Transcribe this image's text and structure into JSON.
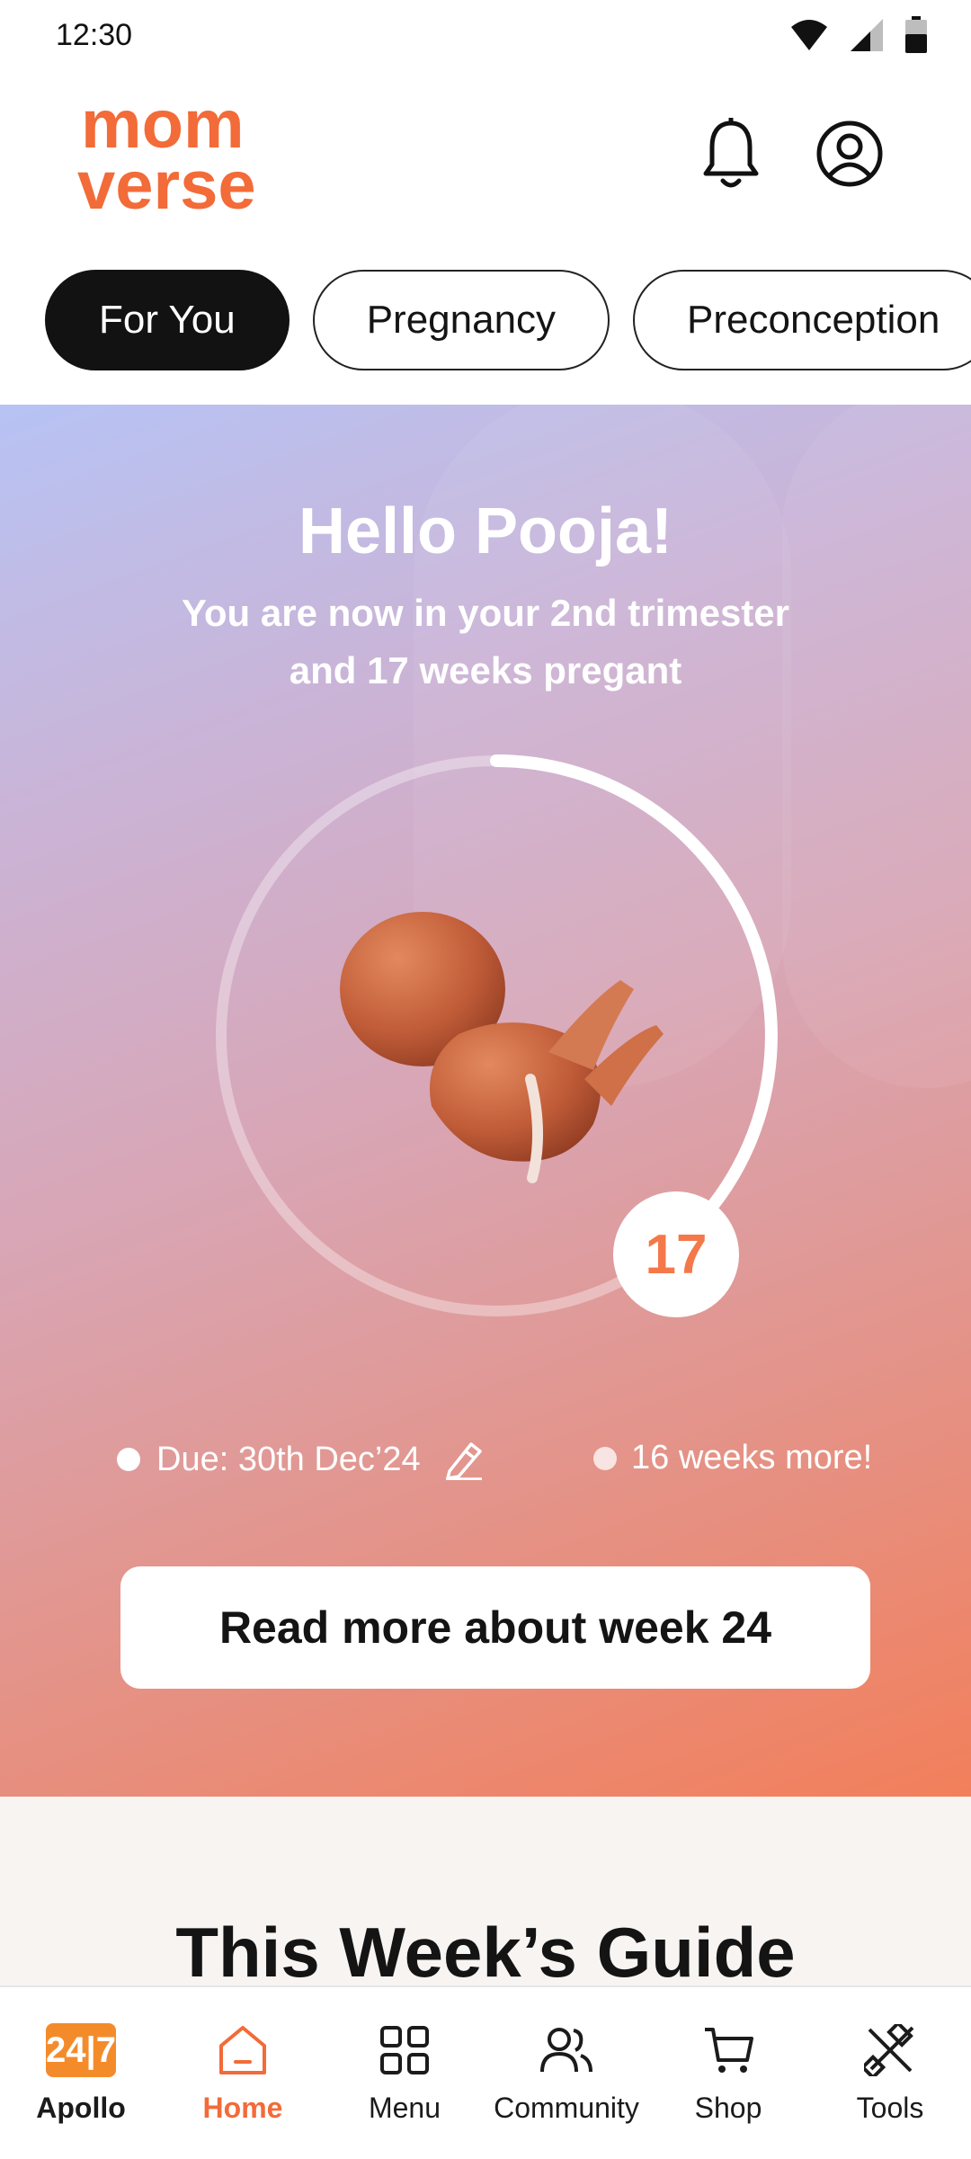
{
  "status_bar": {
    "time": "12:30"
  },
  "header": {
    "logo_line1": "mom",
    "logo_line2": "verse"
  },
  "tabs": [
    {
      "label": "For You",
      "active": true
    },
    {
      "label": "Pregnancy",
      "active": false
    },
    {
      "label": "Preconception",
      "active": false
    }
  ],
  "hero": {
    "greeting": "Hello Pooja!",
    "subtitle_line1": "You are now in your 2nd trimester",
    "subtitle_line2": "and 17 weeks pregant",
    "week": "17",
    "progress_fraction": 0.42,
    "due_label": "Due: 30th Dec’24",
    "remaining_label": "16 weeks more!",
    "cta_label": "Read more about week 24"
  },
  "guide": {
    "title": "This Week’s Guide"
  },
  "bottom_nav": [
    {
      "label": "Apollo",
      "icon": "apollo-247-icon",
      "badge": "24|7"
    },
    {
      "label": "Home",
      "icon": "home-icon",
      "active": true
    },
    {
      "label": "Menu",
      "icon": "grid-menu-icon"
    },
    {
      "label": "Community",
      "icon": "community-icon"
    },
    {
      "label": "Shop",
      "icon": "cart-icon"
    },
    {
      "label": "Tools",
      "icon": "tools-icon"
    }
  ],
  "colors": {
    "accent": "#F26B38",
    "dark": "#121212"
  }
}
